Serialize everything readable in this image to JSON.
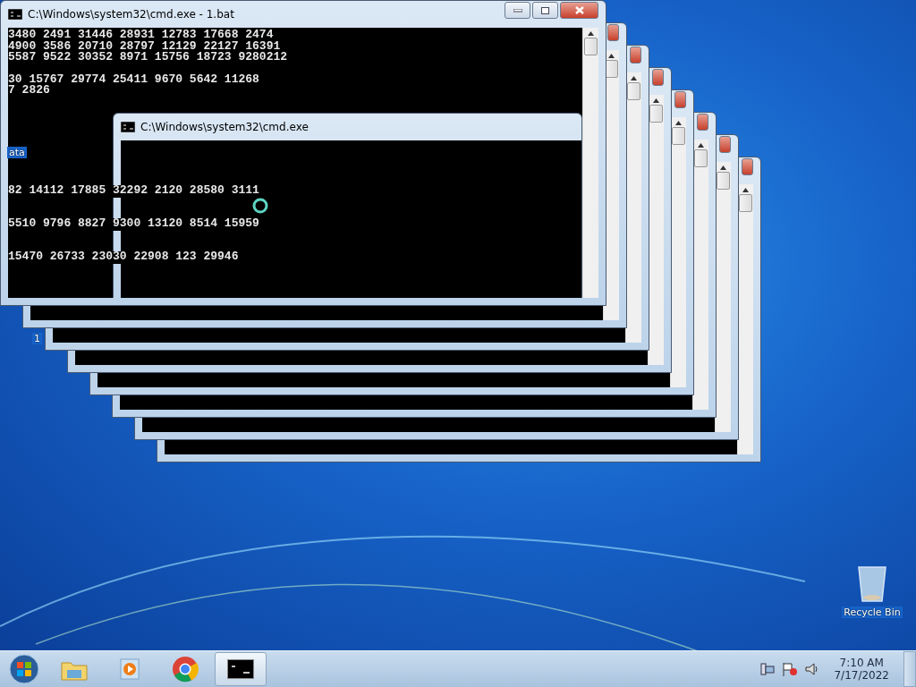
{
  "desktop_icons": [
    {
      "label": "ata"
    },
    {
      "label": "1"
    }
  ],
  "back_windows": [
    {
      "close_button": true
    },
    {
      "close_button": true
    },
    {
      "close_button": true
    },
    {
      "close_button": true
    },
    {
      "close_button": true
    },
    {
      "close_button": true
    },
    {
      "close_button": true
    }
  ],
  "main_window": {
    "title": "C:\\Windows\\system32\\cmd.exe - 1.bat",
    "line_blocks": [
      [
        "3480 2491 31446 28931 12783 17668 2474",
        "4900 3586 20710 28797 12129 22127 16391",
        "5587 9522 30352 8971 15756 18723 9280212"
      ],
      [
        "30 15767 29774 25411 9670 5642 11268",
        "7 2826"
      ]
    ],
    "inner_window": {
      "title": "C:\\Windows\\system32\\cmd.exe"
    },
    "lower_lines": [
      "82 14112 17885 32292 2120 28580 3111",
      "5510 9796 8827 9300 13120 8514 15959",
      "15470 26733 23030 22908 123 29946"
    ]
  },
  "recycle_bin": {
    "label": "Recycle Bin"
  },
  "taskbar": {
    "items": [
      {
        "kind": "explorer",
        "selected": false
      },
      {
        "kind": "media",
        "selected": false
      },
      {
        "kind": "chrome",
        "selected": false
      },
      {
        "kind": "cmd",
        "selected": true
      }
    ],
    "clock": {
      "time": "7:10 AM",
      "date": "7/17/2022"
    }
  }
}
